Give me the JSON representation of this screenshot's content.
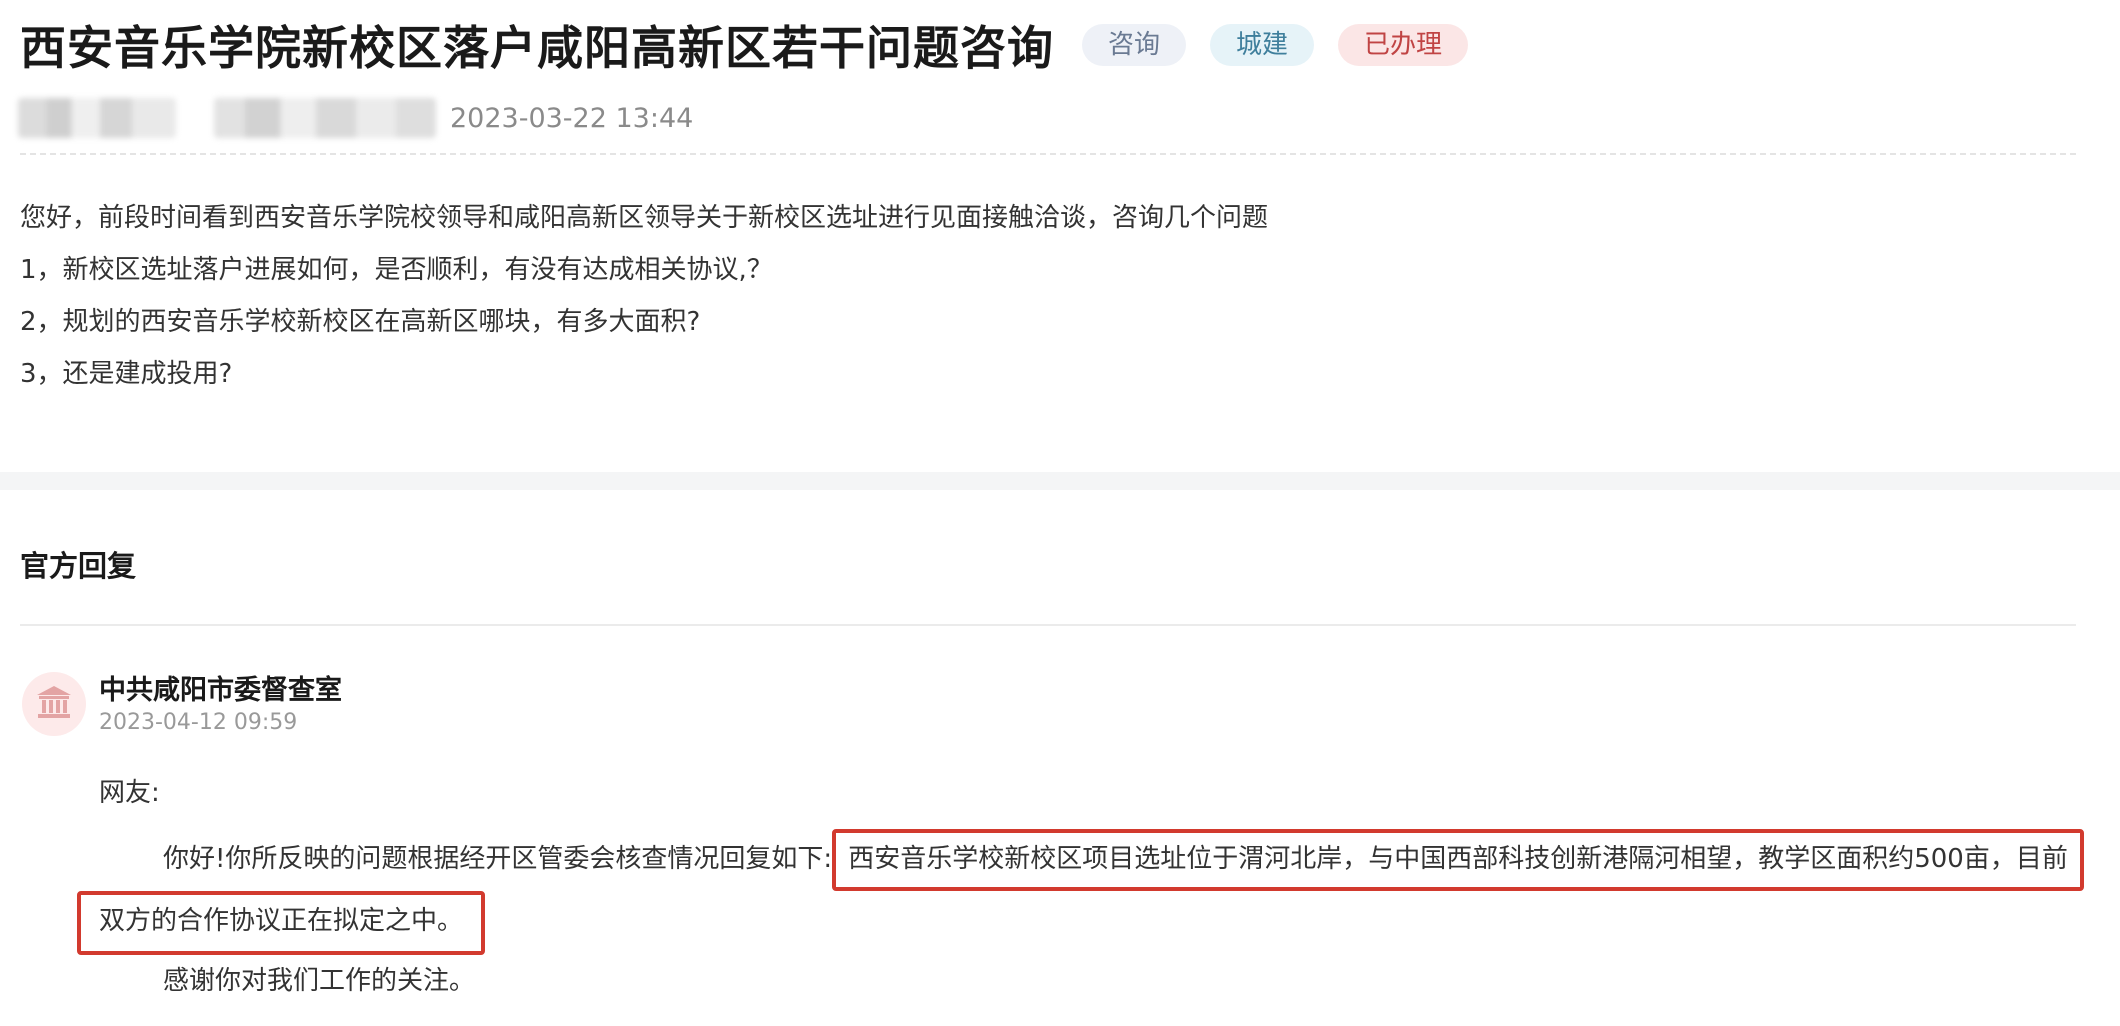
{
  "header": {
    "title": "西安音乐学院新校区落户咸阳高新区若干问题咨询",
    "tags": [
      "咨询",
      "城建",
      "已办理"
    ],
    "post_time": "2023-03-22 13:44"
  },
  "question": {
    "lines": [
      "您好，前段时间看到西安音乐学院校领导和咸阳高新区领导关于新校区选址进行见面接触洽谈，咨询几个问题",
      "1，新校区选址落户进展如何，是否顺利，有没有达成相关协议,？",
      "2，规划的西安音乐学校新校区在高新区哪块，有多大面积?",
      "3，还是建成投用?"
    ]
  },
  "reply": {
    "heading": "官方回复",
    "org_name": "中共咸阳市委督查室",
    "org_time": "2023-04-12 09:59",
    "salutation": "网友:",
    "intro": "你好!你所反映的问题根据经开区管委会核查情况回复如下:",
    "highlight_part1": "西安音乐学校新校区项目选址位于渭河北岸，与中国西部科技创新港隔河相望，教学区面积约500亩，目前",
    "highlight_part2": "双方的合作协议正在拟定之中。",
    "closing": "感谢你对我们工作的关注。"
  },
  "colors": {
    "highlight_border": "#d23a2e",
    "tag_consult": "#6a7a93",
    "tag_build": "#3f7f9c",
    "tag_done": "#c04444"
  },
  "icons": {
    "org_avatar": "government-building-icon"
  }
}
